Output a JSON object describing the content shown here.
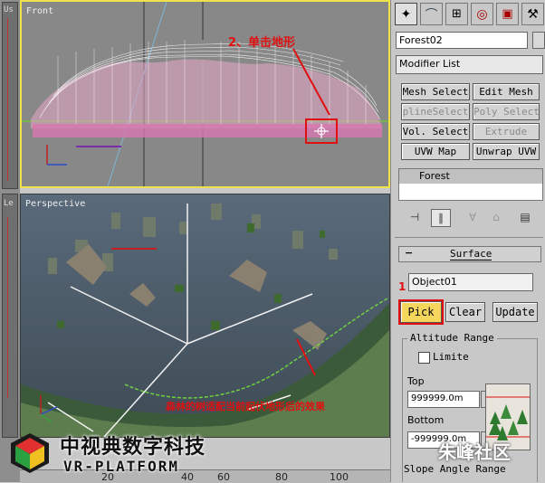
{
  "viewports": {
    "front": {
      "label": "Front",
      "annotation": "2、单击地形"
    },
    "perspective": {
      "label": "Perspective",
      "annotation": "森林的树适配当前起伏地形后的效果"
    },
    "left_labels": [
      "Us",
      "Le"
    ]
  },
  "command_panel": {
    "object_name": "Forest02",
    "modifier_list": "Modifier List",
    "modifier_buttons": [
      "Mesh Select",
      "Edit Mesh",
      "plineSelect",
      "Poly Select",
      "Vol. Select",
      "Extrude",
      "UVW Map",
      "Unwrap UVW"
    ],
    "stack_item": "Forest",
    "surface_rollout": {
      "title": "Surface",
      "object_field": "Object01",
      "step_marker": "1",
      "pick": "Pick",
      "clear": "Clear",
      "update": "Update",
      "altitude_range": "Altitude Range",
      "limit": "Limite",
      "top_label": "Top",
      "top_value": "999999.0m",
      "bottom_label": "Bottom",
      "bottom_value": "-999999.0m",
      "slope_angle_range": "Slope Angle Range"
    }
  },
  "watermark": {
    "title": "中视典数字科技",
    "subtitle": "VR-PLATFORM",
    "forum": "朱峰社区"
  },
  "ruler": {
    "ticks": [
      "20",
      "40",
      "60",
      "80",
      "100"
    ]
  },
  "colors": {
    "accent_yellow": "#f0e04a",
    "annotation_red": "#e01010",
    "pick_highlight": "#f5d65c"
  }
}
